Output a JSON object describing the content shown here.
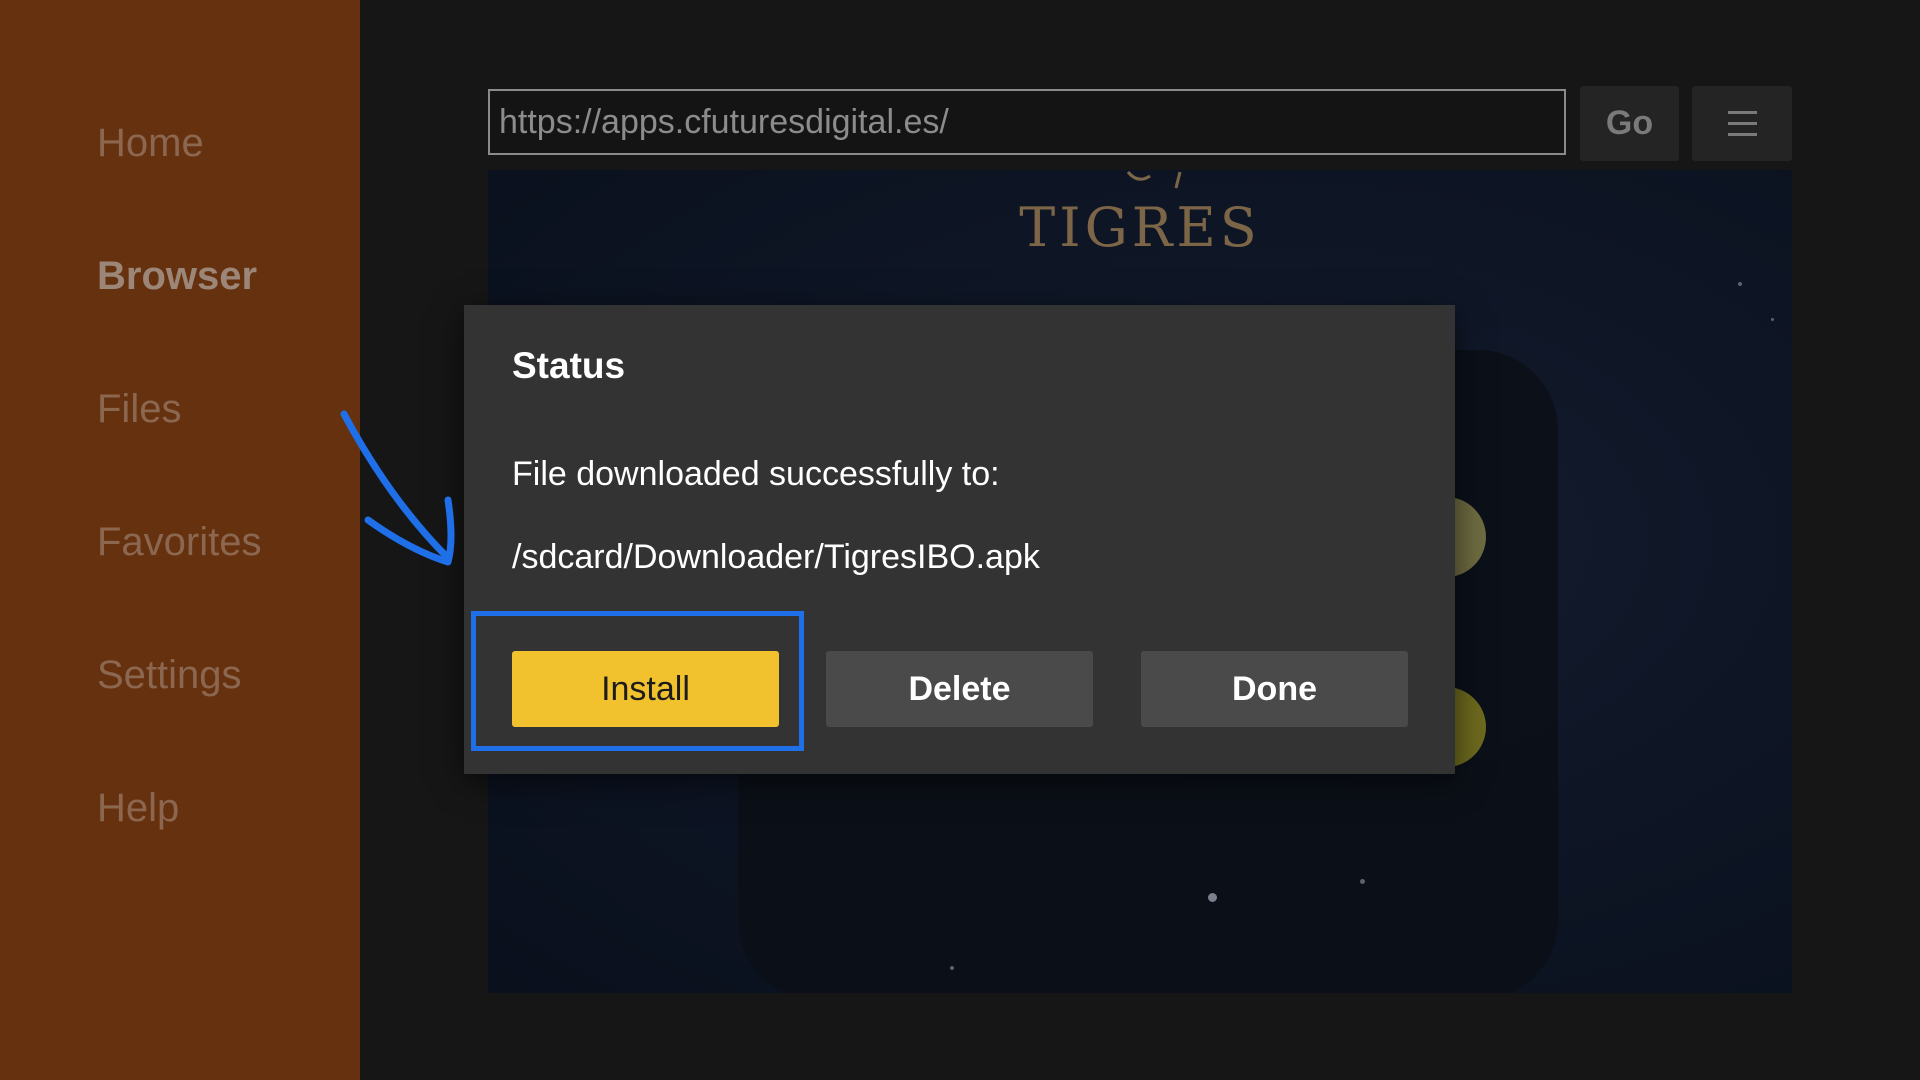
{
  "sidebar": {
    "items": [
      {
        "label": "Home",
        "active": false
      },
      {
        "label": "Browser",
        "active": true
      },
      {
        "label": "Files",
        "active": false
      },
      {
        "label": "Favorites",
        "active": false
      },
      {
        "label": "Settings",
        "active": false
      },
      {
        "label": "Help",
        "active": false
      }
    ]
  },
  "toolbar": {
    "url": "https://apps.cfuturesdigital.es/",
    "go_label": "Go",
    "menu_icon": "hamburger-menu-icon"
  },
  "web": {
    "logo_text": "TIGRES"
  },
  "dialog": {
    "title": "Status",
    "message": "File downloaded successfully to:",
    "path": "/sdcard/Downloader/TigresIBO.apk",
    "buttons": {
      "install": "Install",
      "delete": "Delete",
      "done": "Done"
    }
  },
  "annotation": {
    "highlight_color": "#1f6fe8",
    "arrow_icon": "arrow-icon"
  },
  "colors": {
    "sidebar_bg": "#66310f",
    "accent_yellow": "#f2c12e",
    "dialog_bg": "#333333"
  }
}
